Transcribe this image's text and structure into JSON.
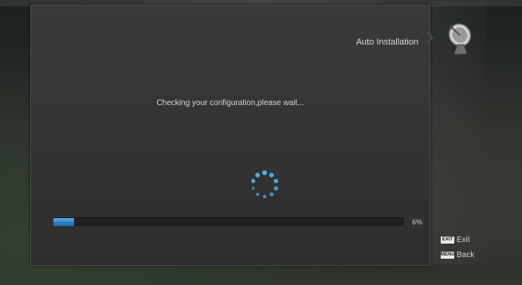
{
  "header": {
    "title": "Auto Installation"
  },
  "status": {
    "message": "Checking your configuration,please wait..."
  },
  "progress": {
    "value": 6,
    "label": "6%"
  },
  "help": [
    {
      "key": "EXIT",
      "label": "Exit"
    },
    {
      "key": "MENU",
      "label": "Back"
    }
  ],
  "icons": {
    "menu_icon": "satellite-dish-icon",
    "spinner": "loading-spinner-icon"
  },
  "colors": {
    "accent": "#2a7fc0",
    "spinner": "#4fb0e8"
  }
}
